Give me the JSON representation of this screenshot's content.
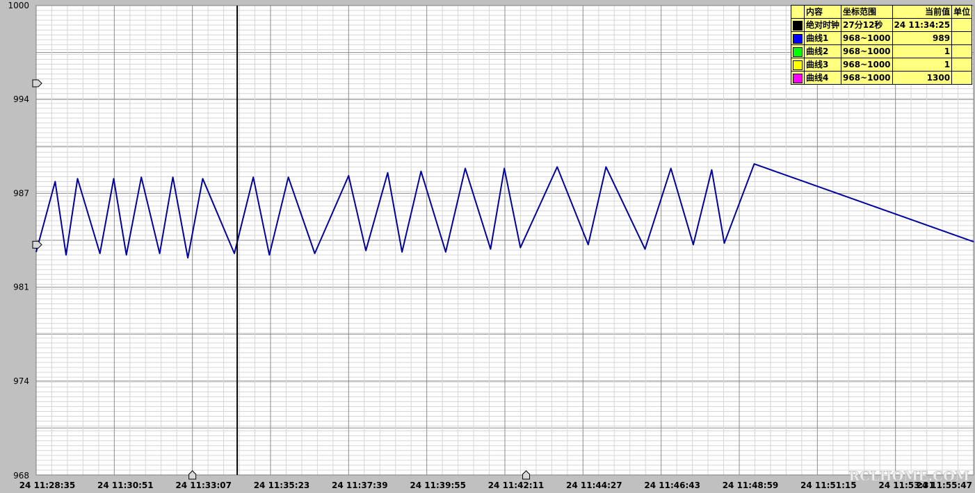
{
  "colors": {
    "background": "#c0c0c0",
    "plot_bg": "#ffffff",
    "grid_minor": "#d6d6d6",
    "grid_major": "#8a8a8a",
    "legend_bg": "#ffff80"
  },
  "legend": {
    "headers": [
      "内容",
      "坐标范围",
      "当前值",
      "单位"
    ],
    "rows": [
      {
        "name": "绝对时钟",
        "range": "27分12秒",
        "value": "24 11:34:25",
        "unit": "",
        "color": "#000000"
      },
      {
        "name": "曲线1",
        "range": "968~1000",
        "value": "989",
        "unit": "",
        "color": "#0000ff"
      },
      {
        "name": "曲线2",
        "range": "968~1000",
        "value": "1",
        "unit": "",
        "color": "#00ff00"
      },
      {
        "name": "曲线3",
        "range": "968~1000",
        "value": "1",
        "unit": "",
        "color": "#ffff00"
      },
      {
        "name": "曲线4",
        "range": "968~1000",
        "value": "1300",
        "unit": "",
        "color": "#ff00ff"
      }
    ]
  },
  "watermark": "RCLHOME.COM",
  "chart_data": {
    "type": "line",
    "title": "",
    "xlabel": "",
    "ylabel": "",
    "ylim": [
      968,
      1000
    ],
    "yticks": [
      "1000",
      "994",
      "987",
      "981",
      "974",
      "968"
    ],
    "xlim": [
      "24 11:28:35",
      "24 11:55:47"
    ],
    "xticks": [
      "24 11:28:35",
      "24 11:30:51",
      "24 11:33:07",
      "24 11:35:23",
      "24 11:37:39",
      "24 11:39:55",
      "24 11:42:11",
      "24 11:44:27",
      "24 11:46:43",
      "24 11:48:59",
      "24 11:51:15",
      "24 11:53:31",
      "24 11:55:47"
    ],
    "cursor_time": "24 11:34:25",
    "grid": true,
    "series": [
      {
        "name": "曲线1",
        "color": "#0000a0",
        "x": [
          "24 11:28:35",
          "24 11:29:08",
          "24 11:29:27",
          "24 11:29:47",
          "24 11:30:26",
          "24 11:30:50",
          "24 11:31:12",
          "24 11:31:38",
          "24 11:32:10",
          "24 11:32:33",
          "24 11:32:59",
          "24 11:33:25",
          "24 11:34:20",
          "24 11:34:53",
          "24 11:35:21",
          "24 11:35:54",
          "24 11:36:40",
          "24 11:37:39",
          "24 11:38:09",
          "24 11:38:47",
          "24 11:39:12",
          "24 11:39:45",
          "24 11:40:28",
          "24 11:41:02",
          "24 11:41:46",
          "24 11:42:10",
          "24 11:42:38",
          "24 11:43:42",
          "24 11:44:36",
          "24 11:45:07",
          "24 11:46:15",
          "24 11:47:00",
          "24 11:47:39",
          "24 11:48:11",
          "24 11:48:33",
          "24 11:49:25",
          "24 11:55:47"
        ],
        "y": [
          983.2,
          988.0,
          983.0,
          988.2,
          983.1,
          988.2,
          983.0,
          988.3,
          983.1,
          988.3,
          982.8,
          988.2,
          983.1,
          988.3,
          983.0,
          988.3,
          983.1,
          988.4,
          983.3,
          988.6,
          983.2,
          988.7,
          983.2,
          988.9,
          983.4,
          988.9,
          983.5,
          989.0,
          983.7,
          989.0,
          983.4,
          988.9,
          983.7,
          988.8,
          983.8,
          989.2,
          983.9
        ]
      }
    ]
  }
}
